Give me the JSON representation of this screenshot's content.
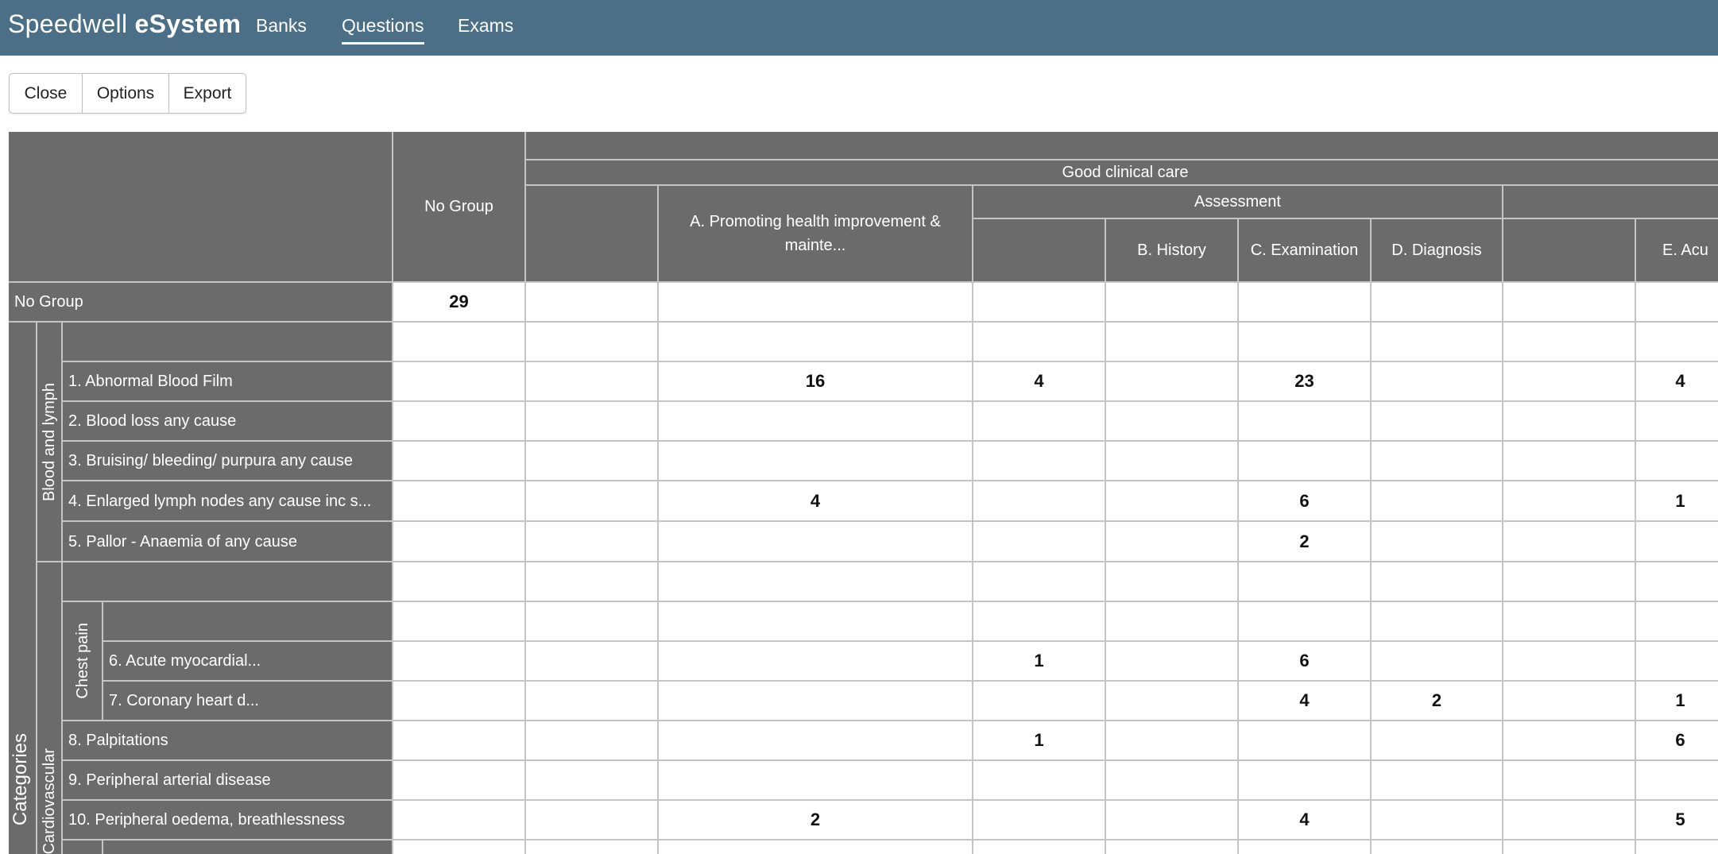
{
  "app": {
    "brand_part1": "Speedwell ",
    "brand_part2": "eSystem",
    "nav": [
      {
        "label": "Banks"
      },
      {
        "label": "Questions"
      },
      {
        "label": "Exams"
      }
    ]
  },
  "toolbar": {
    "close_label": "Close",
    "options_label": "Options",
    "export_label": "Export"
  },
  "grid": {
    "col_headers": {
      "no_group": "No Group",
      "good_clinical_care": "Good clinical care",
      "promoting_health": "A. Promoting health improvement & mainte...",
      "assessment": "Assessment",
      "history": "B. History",
      "examination": "C. Examination",
      "diagnosis": "D. Diagnosis",
      "acute": "E. Acu"
    },
    "row_groups": {
      "categories": "Categories",
      "blood_and_lymph": "Blood and lymph",
      "cardiovascular": "Cardiovascular",
      "chest_pain": "Chest pain"
    },
    "rows": [
      {
        "label": "No Group",
        "values": [
          "29",
          "",
          "",
          "",
          "",
          "",
          "",
          "",
          ""
        ]
      },
      {
        "label": "",
        "values": [
          "",
          "",
          "",
          "",
          "",
          "",
          "",
          "",
          ""
        ]
      },
      {
        "label": "1. Abnormal Blood Film",
        "values": [
          "",
          "",
          "16",
          "4",
          "",
          "23",
          "",
          "",
          "4"
        ]
      },
      {
        "label": "2. Blood loss any cause",
        "values": [
          "",
          "",
          "",
          "",
          "",
          "",
          "",
          "",
          ""
        ]
      },
      {
        "label": "3. Bruising/ bleeding/ purpura any cause",
        "values": [
          "",
          "",
          "",
          "",
          "",
          "",
          "",
          "",
          ""
        ]
      },
      {
        "label": "4. Enlarged lymph nodes any cause inc s...",
        "values": [
          "",
          "",
          "4",
          "",
          "",
          "6",
          "",
          "",
          "1"
        ]
      },
      {
        "label": "5. Pallor - Anaemia of any cause",
        "values": [
          "",
          "",
          "",
          "",
          "",
          "2",
          "",
          "",
          ""
        ]
      },
      {
        "label": "",
        "values": [
          "",
          "",
          "",
          "",
          "",
          "",
          "",
          "",
          ""
        ]
      },
      {
        "label": "",
        "values": [
          "",
          "",
          "",
          "",
          "",
          "",
          "",
          "",
          ""
        ]
      },
      {
        "label": "6. Acute myocardial...",
        "values": [
          "",
          "",
          "",
          "1",
          "",
          "6",
          "",
          "",
          ""
        ]
      },
      {
        "label": "7. Coronary heart d...",
        "values": [
          "",
          "",
          "",
          "",
          "",
          "4",
          "2",
          "",
          "1"
        ]
      },
      {
        "label": "8. Palpitations",
        "values": [
          "",
          "",
          "",
          "1",
          "",
          "",
          "",
          "",
          "6"
        ]
      },
      {
        "label": "9. Peripheral arterial disease",
        "values": [
          "",
          "",
          "",
          "",
          "",
          "",
          "",
          "",
          ""
        ]
      },
      {
        "label": "10. Peripheral oedema, breathlessness",
        "values": [
          "",
          "",
          "2",
          "",
          "",
          "4",
          "",
          "",
          "5"
        ]
      },
      {
        "label": "",
        "values": [
          "",
          "",
          "",
          "",
          "",
          "",
          "",
          "",
          ""
        ]
      }
    ]
  }
}
